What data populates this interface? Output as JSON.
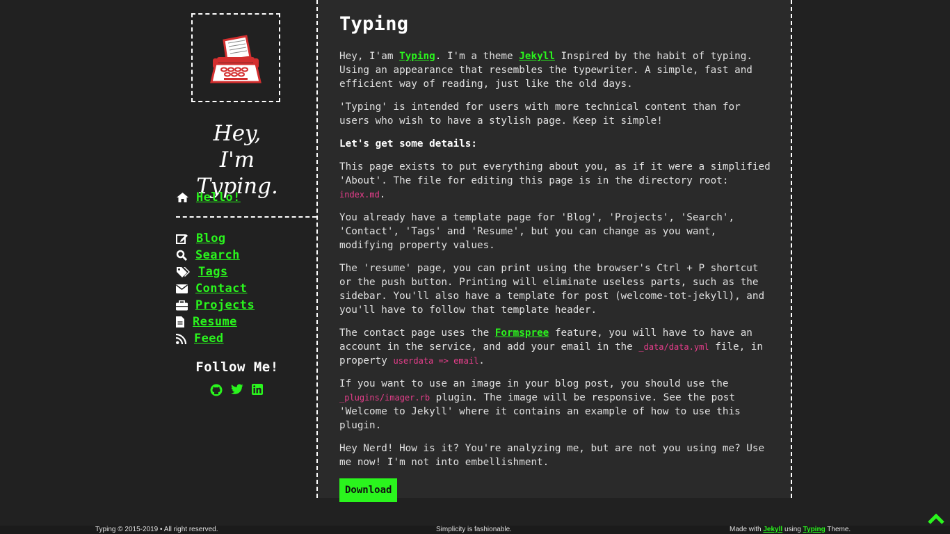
{
  "sidebar": {
    "greeting_line1": "Hey,",
    "greeting_line2": "I'm Typing.",
    "hello": {
      "label": "Hello!",
      "icon": "home-icon"
    },
    "nav": [
      {
        "label": "Blog",
        "icon": "edit-icon"
      },
      {
        "label": "Search",
        "icon": "search-icon"
      },
      {
        "label": "Tags",
        "icon": "tags-icon"
      },
      {
        "label": "Contact",
        "icon": "envelope-icon"
      },
      {
        "label": "Projects",
        "icon": "briefcase-icon"
      },
      {
        "label": "Resume",
        "icon": "file-icon"
      },
      {
        "label": "Feed",
        "icon": "rss-icon"
      }
    ],
    "follow_title": "Follow Me!",
    "social": [
      "github-icon",
      "twitter-icon",
      "linkedin-icon"
    ]
  },
  "main": {
    "title": "Typing",
    "p1": {
      "t1": "Hey, I'am ",
      "link1": "Typing",
      "t2": ". I'm a theme ",
      "link2": "Jekyll",
      "t3": " Inspired by the habit of typing. Using an appearance that resembles the typewriter. A simple, fast and efficient way of reading, just like the old days."
    },
    "p2": "'Typing' is intended for users with more technical content than for users who wish to have a stylish page. Keep it simple!",
    "p3": "Let's get some details:",
    "p4": {
      "t1": "This page exists to put everything about you, as if it were a simplified 'About'. The file for editing this page is in the directory root: ",
      "code": "index.md",
      "t2": "."
    },
    "p5": "You already have a template page for 'Blog', 'Projects', 'Search', 'Contact', 'Tags' and 'Resume', but you can change as you want, modifying property values.",
    "p6": "The 'resume' page, you can print using the browser's Ctrl + P shortcut or the push button. Printing will eliminate useless parts, such as the sidebar. You'll also have a template for post (welcome-tot-jekyll), and you'll have to follow that template header.",
    "p7": {
      "t1": "The contact page uses the ",
      "link": "Formspree",
      "t2": " feature, you will have to have an account in the service, and add your email in the ",
      "code1": "_data/data.yml",
      "t3": " file, in property ",
      "code2": "userdata => email",
      "t4": "."
    },
    "p8": {
      "t1": "If you want to use an image in your blog post, you should use the ",
      "code": "_plugins/imager.rb",
      "t2": " plugin. The image will be responsive. See the post 'Welcome to Jekyll' where it contains an example of how to use this plugin."
    },
    "p9": "Hey Nerd! How is it? You're analyzing me, but are not you using me? Use me now! I'm not into embellishment.",
    "download_label": "Download"
  },
  "footer": {
    "left": "Typing © 2015-2019 • All right reserved.",
    "center": "Simplicity is fashionable.",
    "right_t1": "Made with ",
    "right_link1": "Jekyll",
    "right_t2": " using ",
    "right_link2": "Typing",
    "right_t3": " Theme."
  },
  "colors": {
    "accent": "#2af51d",
    "background": "#212121",
    "panel": "#2a2a2a",
    "code": "#e83e8c"
  }
}
